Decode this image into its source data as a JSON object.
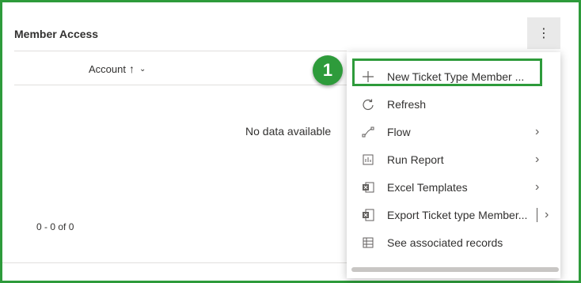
{
  "panel": {
    "title": "Member Access",
    "more_icon": "vertical-ellipsis-icon"
  },
  "grid": {
    "column_header": "Account",
    "sort_indicator": "↑",
    "no_data_text": "No data available",
    "pager_text": "0 - 0 of 0"
  },
  "menu": {
    "items": [
      {
        "label": "New Ticket Type Member ...",
        "icon": "plus-icon"
      },
      {
        "label": "Refresh",
        "icon": "refresh-icon"
      },
      {
        "label": "Flow",
        "icon": "flow-icon",
        "submenu": true
      },
      {
        "label": "Run Report",
        "icon": "report-icon",
        "submenu": true
      },
      {
        "label": "Excel Templates",
        "icon": "excel-icon",
        "submenu": true
      },
      {
        "label": "Export Ticket type Member...",
        "icon": "excel-export-icon",
        "split_submenu": true
      },
      {
        "label": "See associated records",
        "icon": "associated-records-icon"
      }
    ]
  },
  "callout": {
    "number": "1",
    "color": "#2e9b3b"
  }
}
